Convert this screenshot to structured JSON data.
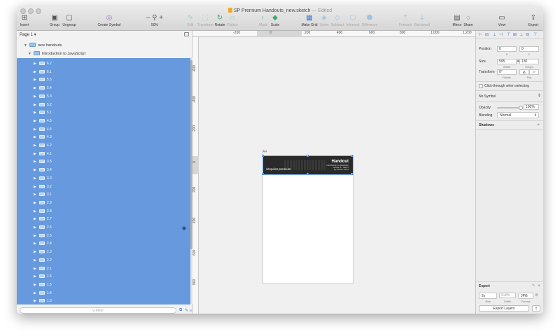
{
  "window": {
    "title": "SP Premium Handouts_new.sketch",
    "title_status": "— Edited"
  },
  "toolbar": {
    "insert": "Insert",
    "group": "Group",
    "ungroup": "Ungroup",
    "create_symbol": "Create Symbol",
    "zoom_value": "50%",
    "edit": "Edit",
    "transform": "Transform",
    "rotate": "Rotate",
    "flatten": "Flatten",
    "mask": "Mask",
    "scale": "Scale",
    "make_grid": "Make Grid",
    "union": "Union",
    "subtract": "Subtract",
    "intersect": "Intersect",
    "difference": "Difference",
    "forward": "Forward",
    "backward": "Backward",
    "mirror": "Mirror",
    "share": "Share",
    "view": "View",
    "export": "Export"
  },
  "layers": {
    "page": "Page 1 ▾",
    "root_group": "new handouts",
    "artboard": "Introduction to JavaScript",
    "items": [
      "6.2",
      "6.1",
      "5.5",
      "5.4",
      "5.3",
      "5.2",
      "5.1",
      "4.5",
      "4.4",
      "4.3",
      "4.2",
      "4.1",
      "3.5",
      "3.4",
      "3.3",
      "3.2",
      "3.1",
      "2.9",
      "2.8",
      "2.7",
      "2.6",
      "2.5",
      "2.4",
      "2.3",
      "2.2",
      "2.1",
      "1.6",
      "1.5",
      "1.4",
      "1.3"
    ],
    "filter_placeholder": "Filter",
    "filter_count": "15"
  },
  "rulers": {
    "top": [
      "-200",
      "0",
      "200",
      "400",
      "600",
      "800",
      "1,000",
      "1,200"
    ],
    "left": [
      "-600",
      "-400",
      "-200",
      "0",
      "200",
      "400",
      "600",
      "800",
      "1,000"
    ]
  },
  "canvas": {
    "artboard_label": "A4",
    "banner_brand": "sitepoint premium",
    "banner_title": "Handout",
    "banner_sub": "Introduction to JavaScript\nLesson 6 · Step 2\nBy Darren Jones"
  },
  "inspector": {
    "position_label": "Position",
    "pos_x": "0",
    "pos_y": "0",
    "x_cap": "X",
    "y_cap": "Y",
    "size_label": "Size",
    "width": "595",
    "height": "130",
    "width_cap": "Width",
    "height_cap": "Height",
    "transform_label": "Transform",
    "rotate_value": "0°",
    "rotate_cap": "Rotate",
    "flip_cap": "Flip",
    "click_through": "Click-through when selecting",
    "symbol": "No Symbol",
    "opacity_label": "Opacity",
    "opacity_value": "100%",
    "opacity": 1.0,
    "blending_label": "Blending",
    "blending_value": "Normal",
    "shadows": "Shadows",
    "export_title": "Export",
    "export_scale": "2x",
    "export_suffix_placeholder": "Suffix",
    "export_format": "JPG",
    "size_cap": "Size",
    "suffix_cap": "Suffix",
    "format_cap": "Format",
    "export_layers": "Export Layers"
  }
}
